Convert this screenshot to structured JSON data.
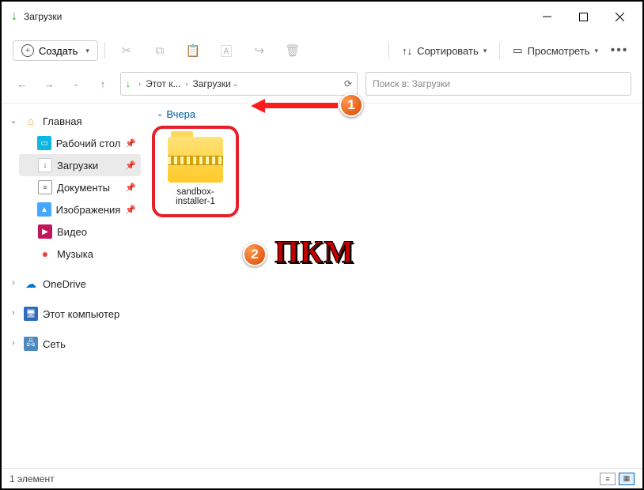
{
  "window": {
    "title": "Загрузки"
  },
  "toolbar": {
    "create": "Создать",
    "sort": "Сортировать",
    "view": "Просмотреть"
  },
  "breadcrumb": {
    "parts": [
      "Этот к...",
      "Загрузки"
    ]
  },
  "search": {
    "placeholder": "Поиск в: Загрузки"
  },
  "sidebar": {
    "home": "Главная",
    "desktop": "Рабочий стол",
    "downloads": "Загрузки",
    "documents": "Документы",
    "pictures": "Изображения",
    "videos": "Видео",
    "music": "Музыка",
    "onedrive": "OneDrive",
    "this_pc": "Этот компьютер",
    "network": "Сеть"
  },
  "content": {
    "group": "Вчера",
    "file_name": "sandbox-installer-1"
  },
  "annotations": {
    "step1": "1",
    "step2": "2",
    "pkm": "ПКМ"
  },
  "status": {
    "count": "1 элемент"
  }
}
